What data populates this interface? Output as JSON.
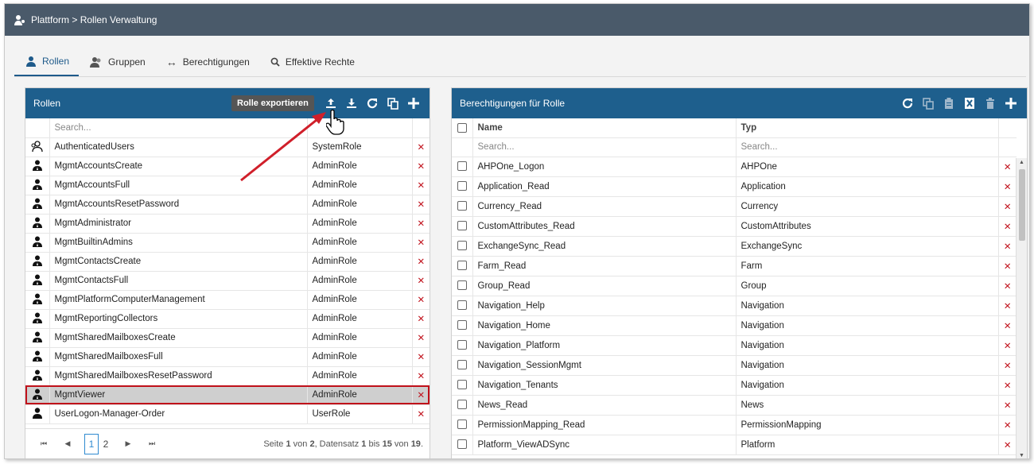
{
  "breadcrumb": "Plattform > Rollen Verwaltung",
  "tabs": [
    {
      "label": "Rollen",
      "icon": "role-icon",
      "active": true
    },
    {
      "label": "Gruppen",
      "icon": "group-icon"
    },
    {
      "label": "Berechtigungen",
      "icon": "arrows-icon"
    },
    {
      "label": "Effektive Rechte",
      "icon": "search-icon"
    }
  ],
  "roles_panel": {
    "title": "Rollen",
    "tooltip": "Rolle exportieren",
    "search_placeholder": "Search...",
    "rows": [
      {
        "name": "AuthenticatedUsers",
        "type": "SystemRole",
        "icon": "users-outline-icon"
      },
      {
        "name": "MgmtAccountsCreate",
        "type": "AdminRole",
        "icon": "admin-user-icon"
      },
      {
        "name": "MgmtAccountsFull",
        "type": "AdminRole",
        "icon": "admin-user-icon"
      },
      {
        "name": "MgmtAccountsResetPassword",
        "type": "AdminRole",
        "icon": "admin-user-icon"
      },
      {
        "name": "MgmtAdministrator",
        "type": "AdminRole",
        "icon": "admin-user-icon"
      },
      {
        "name": "MgmtBuiltinAdmins",
        "type": "AdminRole",
        "icon": "admin-user-icon"
      },
      {
        "name": "MgmtContactsCreate",
        "type": "AdminRole",
        "icon": "admin-user-icon"
      },
      {
        "name": "MgmtContactsFull",
        "type": "AdminRole",
        "icon": "admin-user-icon"
      },
      {
        "name": "MgmtPlatformComputerManagement",
        "type": "AdminRole",
        "icon": "admin-user-icon"
      },
      {
        "name": "MgmtReportingCollectors",
        "type": "AdminRole",
        "icon": "admin-user-icon"
      },
      {
        "name": "MgmtSharedMailboxesCreate",
        "type": "AdminRole",
        "icon": "admin-user-icon"
      },
      {
        "name": "MgmtSharedMailboxesFull",
        "type": "AdminRole",
        "icon": "admin-user-icon"
      },
      {
        "name": "MgmtSharedMailboxesResetPassword",
        "type": "AdminRole",
        "icon": "admin-user-icon"
      },
      {
        "name": "MgmtViewer",
        "type": "AdminRole",
        "icon": "admin-user-icon",
        "selected": true
      },
      {
        "name": "UserLogon-Manager-Order",
        "type": "UserRole",
        "icon": "user-icon"
      }
    ],
    "pager": {
      "pages": [
        "1",
        "2"
      ],
      "current": "1",
      "info_prefix": "Seite ",
      "page": "1",
      "of_text": " von ",
      "total_pages": "2",
      "records_text": ", Datensatz ",
      "from": "1",
      "to_text": " bis ",
      "to": "15",
      "total": "19",
      "end": "."
    }
  },
  "perm_panel": {
    "title": "Berechtigungen für Rolle",
    "col_name": "Name",
    "col_type": "Typ",
    "search_placeholder": "Search...",
    "rows": [
      {
        "name": "AHPOne_Logon",
        "type": "AHPOne"
      },
      {
        "name": "Application_Read",
        "type": "Application"
      },
      {
        "name": "Currency_Read",
        "type": "Currency"
      },
      {
        "name": "CustomAttributes_Read",
        "type": "CustomAttributes"
      },
      {
        "name": "ExchangeSync_Read",
        "type": "ExchangeSync"
      },
      {
        "name": "Farm_Read",
        "type": "Farm"
      },
      {
        "name": "Group_Read",
        "type": "Group"
      },
      {
        "name": "Navigation_Help",
        "type": "Navigation"
      },
      {
        "name": "Navigation_Home",
        "type": "Navigation"
      },
      {
        "name": "Navigation_Platform",
        "type": "Navigation"
      },
      {
        "name": "Navigation_SessionMgmt",
        "type": "Navigation"
      },
      {
        "name": "Navigation_Tenants",
        "type": "Navigation"
      },
      {
        "name": "News_Read",
        "type": "News"
      },
      {
        "name": "PermissionMapping_Read",
        "type": "PermissionMapping"
      },
      {
        "name": "Platform_ViewADSync",
        "type": "Platform"
      }
    ]
  },
  "colors": {
    "header": "#1e5f8d",
    "topbar": "#4a5a6a",
    "delete": "#c0101a",
    "annotation": "#d01f2a"
  }
}
